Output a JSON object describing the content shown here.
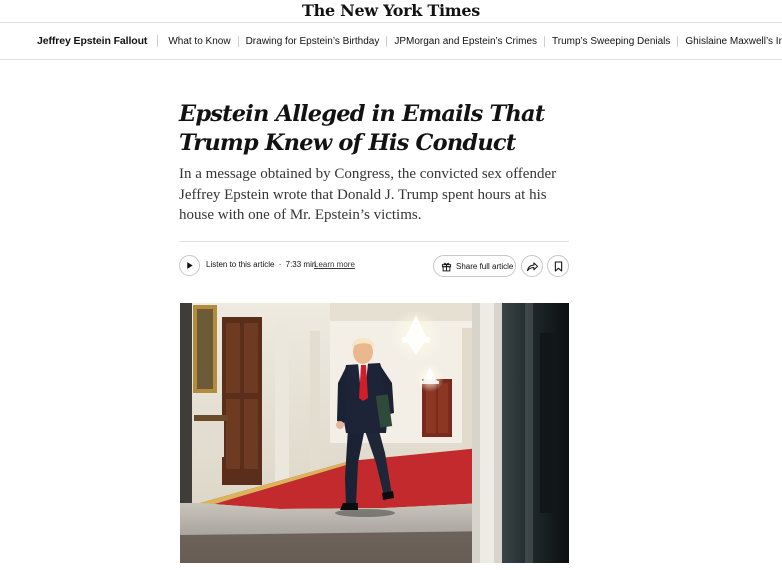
{
  "masthead": {
    "logo_text": "The New York Times"
  },
  "subnav": {
    "section_title": "Jeffrey Epstein Fallout",
    "links": [
      "What to Know",
      "Drawing for Epstein’s Birthday",
      "JPMorgan and Epstein’s Crimes",
      "Trump’s Sweeping Denials",
      "Ghislaine Maxwell’s Interview"
    ]
  },
  "article": {
    "headline": "Epstein Alleged in Emails That Trump Knew of His Conduct",
    "summary": "In a message obtained by Congress, the convicted sex offender Jeffrey Epstein wrote that Donald J. Trump spent hours at his house with one of Mr. Epstein’s victims."
  },
  "toolbar": {
    "listen_label": "Listen to this article",
    "separator": "·",
    "duration": "7:33 min",
    "learn_more": "Learn more",
    "share_full_label": "Share full article",
    "play_icon": "play-icon",
    "gift_icon": "gift-icon",
    "share_icon": "share-arrow-icon",
    "save_icon": "bookmark-icon"
  },
  "colors": {
    "text": "#121212",
    "summary_text": "#363636",
    "carpet_red": "#c22a2e",
    "border": "#c7c7c7"
  }
}
